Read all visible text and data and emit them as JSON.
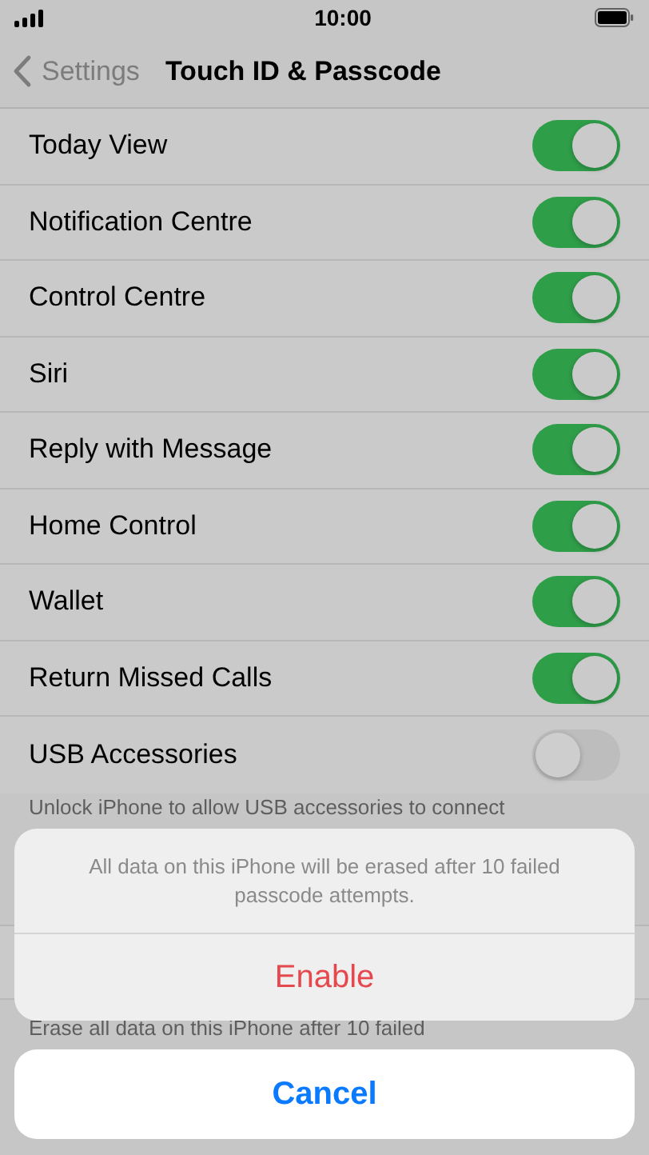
{
  "status_bar": {
    "time": "10:00"
  },
  "nav": {
    "back_label": "Settings",
    "title": "Touch ID & Passcode"
  },
  "rows": [
    {
      "label": "Today View",
      "on": true
    },
    {
      "label": "Notification Centre",
      "on": true
    },
    {
      "label": "Control Centre",
      "on": true
    },
    {
      "label": "Siri",
      "on": true
    },
    {
      "label": "Reply with Message",
      "on": true
    },
    {
      "label": "Home Control",
      "on": true
    },
    {
      "label": "Wallet",
      "on": true
    },
    {
      "label": "Return Missed Calls",
      "on": true
    },
    {
      "label": "USB Accessories",
      "on": false
    }
  ],
  "usb_footer": "Unlock iPhone to allow USB accessories to connect",
  "erase_footer": "Erase all data on this iPhone after 10 failed",
  "action_sheet": {
    "message": "All data on this iPhone will be erased after 10 failed passcode attempts.",
    "actions": [
      {
        "label": "Enable",
        "kind": "destructive"
      }
    ],
    "cancel": "Cancel"
  }
}
